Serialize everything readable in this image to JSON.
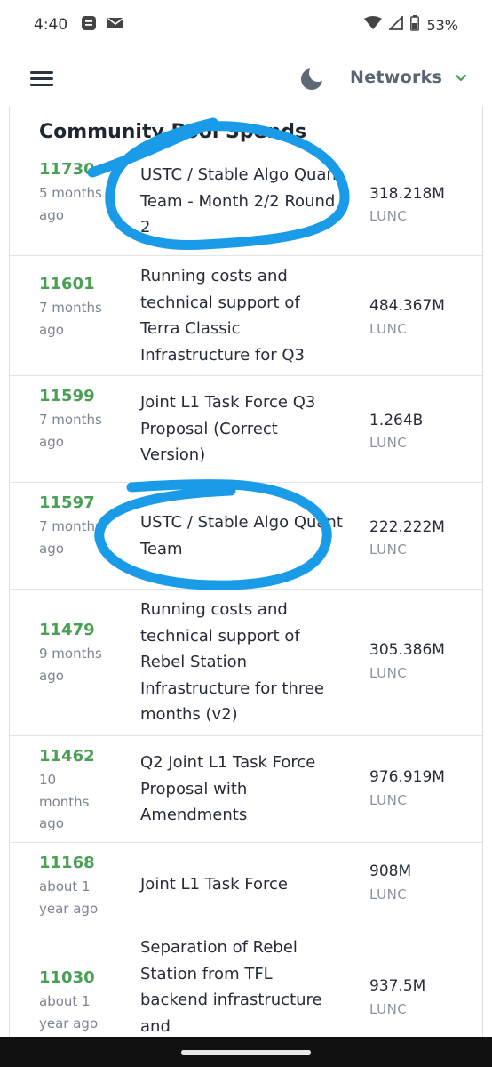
{
  "status_bar": {
    "time": "4:40",
    "battery": "53%",
    "icons": [
      "notification-icon",
      "mail-icon",
      "wifi-icon",
      "signal-icon",
      "battery-icon"
    ]
  },
  "nav": {
    "menu_icon": "hamburger-menu-icon",
    "theme_icon": "moon-icon",
    "networks_label": "Networks",
    "chevron_icon": "chevron-down-icon"
  },
  "card": {
    "title": "Community Pool Spends"
  },
  "spends": [
    {
      "id": "11730",
      "age": "5 months ago",
      "title": "USTC / Stable Algo Quant Team - Month 2/2 Round 2",
      "amount": "318.218M",
      "unit": "LUNC"
    },
    {
      "id": "11601",
      "age": "7 months ago",
      "title": "Running costs and technical support of Terra Classic Infrastructure for Q3",
      "amount": "484.367M",
      "unit": "LUNC"
    },
    {
      "id": "11599",
      "age": "7 months ago",
      "title": "Joint L1 Task Force Q3 Proposal (Correct Version)",
      "amount": "1.264B",
      "unit": "LUNC"
    },
    {
      "id": "11597",
      "age": "7 months ago",
      "title": "USTC / Stable Algo Quant Team",
      "amount": "222.222M",
      "unit": "LUNC"
    },
    {
      "id": "11479",
      "age": "9 months ago",
      "title": "Running costs and technical support of Rebel Station Infrastructure for three months (v2)",
      "amount": "305.386M",
      "unit": "LUNC"
    },
    {
      "id": "11462",
      "age": "10 months ago",
      "title": "Q2 Joint L1 Task Force Proposal with Amendments",
      "amount": "976.919M",
      "unit": "LUNC"
    },
    {
      "id": "11168",
      "age": "about 1 year ago",
      "title": "Joint L1 Task Force",
      "amount": "908M",
      "unit": "LUNC"
    },
    {
      "id": "11030",
      "age": "about 1 year ago",
      "title": "Separation of Rebel Station from TFL backend infrastructure and",
      "amount": "937.5M",
      "unit": "LUNC"
    }
  ],
  "colors": {
    "accent_green": "#49a054",
    "annotation_blue": "#1a9be8",
    "muted_text": "#7b8591"
  }
}
